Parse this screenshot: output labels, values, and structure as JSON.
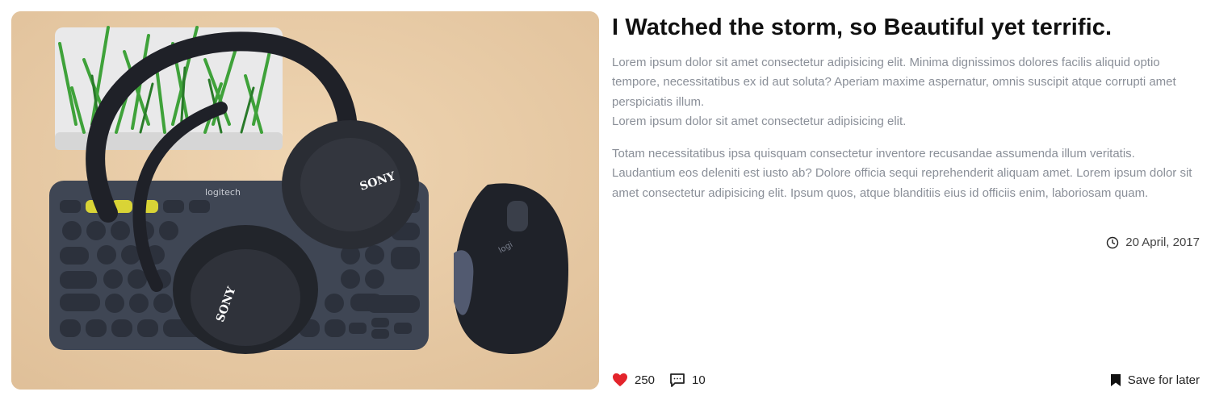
{
  "post": {
    "title": "I Watched the storm, so Beautiful yet terrific.",
    "paragraph1_lines": [
      "Lorem ipsum dolor sit amet consectetur adipisicing elit. Minima dignissimos dolores facilis aliquid optio tempore, necessitatibus ex id aut soluta? Aperiam maxime aspernatur, omnis suscipit atque corrupti amet perspiciatis illum.",
      "Lorem ipsum dolor sit amet consectetur adipisicing elit."
    ],
    "paragraph2": "Totam necessitatibus ipsa quisquam consectetur inventore recusandae assumenda illum veritatis. Laudantium eos deleniti est iusto ab? Dolore officia sequi reprehenderit aliquam amet. Lorem ipsum dolor sit amet consectetur adipisicing elit. Ipsum quos, atque blanditiis eius id officiis enim, laboriosam quam.",
    "date": "20 April, 2017",
    "likes": "250",
    "comments": "10",
    "save_label": "Save for later",
    "image_logos": {
      "keyboard_brand": "logitech",
      "headphone_brand_top": "SONY",
      "headphone_brand_bottom": "SONY",
      "mouse_brand": "logi"
    }
  },
  "icons": {
    "date": "clock-icon",
    "likes": "heart-icon",
    "comments": "comment-icon",
    "save": "bookmark-icon"
  },
  "colors": {
    "heart": "#e3242b",
    "muted_text": "#8a8f98",
    "background_desk": "#e7c9a3"
  }
}
